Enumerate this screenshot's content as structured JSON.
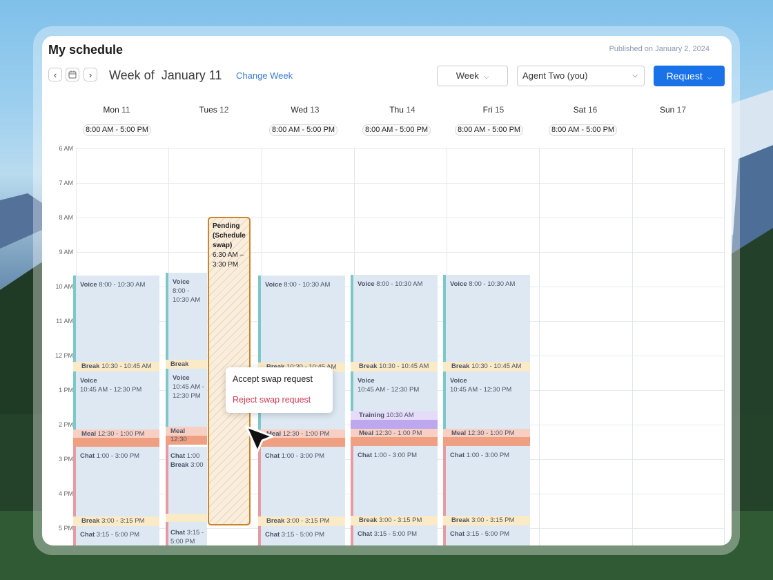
{
  "app": {
    "title": "My schedule",
    "published": "Published on January 2, 2024"
  },
  "toolbar": {
    "prev_icon": "chevron-left-icon",
    "calendar_icon": "calendar-icon",
    "next_icon": "chevron-right-icon",
    "week_of": "Week of  January 11",
    "change_week": "Change Week",
    "view_select": "Week",
    "agent_select": "Agent Two (you)",
    "request_button": "Request"
  },
  "days": [
    {
      "name": "Mon",
      "date": "11",
      "shift": "8:00 AM - 5:00 PM"
    },
    {
      "name": "Tues",
      "date": "12",
      "shift": ""
    },
    {
      "name": "Wed",
      "date": "13",
      "shift": "8:00 AM - 5:00 PM"
    },
    {
      "name": "Thu",
      "date": "14",
      "shift": "8:00 AM - 5:00 PM"
    },
    {
      "name": "Fri",
      "date": "15",
      "shift": "8:00 AM - 5:00 PM"
    },
    {
      "name": "Sat",
      "date": "16",
      "shift": "8:00 AM - 5:00 PM"
    },
    {
      "name": "Sun",
      "date": "17",
      "shift": ""
    }
  ],
  "hours": [
    "6 AM",
    "7 AM",
    "8 AM",
    "9 AM",
    "10 AM",
    "11 AM",
    "12 PM",
    "1 PM",
    "2 PM",
    "3 PM",
    "4 PM",
    "5 PM"
  ],
  "activities": {
    "mon": {
      "voice1_name": "Voice",
      "voice1_time": "8:00 - 10:30 AM",
      "break1_name": "Break",
      "break1_time": "10:30 - 10:45 AM",
      "voice2_name": "Voice",
      "voice2_time": "10:45 AM - 12:30 PM",
      "meal_name": "Meal",
      "meal_time": "12:30 - 1:00 PM",
      "chat1_name": "Chat",
      "chat1_time": "1:00 - 3:00 PM",
      "break2_name": "Break",
      "break2_time": "3:00 - 3:15 PM",
      "chat2_name": "Chat",
      "chat2_time": "3:15 - 5:00 PM"
    },
    "tue": {
      "voice1_name": "Voice",
      "voice1_time": "8:00 - 10:30 AM",
      "break1_name": "Break",
      "voice2_name": "Voice",
      "voice2_time": "10:45 AM - 12:30 PM",
      "meal_name": "Meal",
      "meal_time": "12:30",
      "chat1_name": "Chat",
      "chat1_time": "1:00",
      "break2_name": "Break",
      "break2_time": "3:00",
      "chat2_name": "Chat",
      "chat2_time": "3:15 - 5:00 PM"
    },
    "wed": {
      "voice1_name": "Voice",
      "voice1_time": "8:00 - 10:30 AM",
      "break1_name": "Break",
      "break1_time": "10:30 - 10:45 AM",
      "meal_name": "Meal",
      "meal_time": "12:30 - 1:00 PM",
      "chat1_name": "Chat",
      "chat1_time": "1:00 - 3:00 PM",
      "break2_name": "Break",
      "break2_time": "3:00 - 3:15 PM",
      "chat2_name": "Chat",
      "chat2_time": "3:15 - 5:00 PM"
    },
    "thu": {
      "voice1_name": "Voice",
      "voice1_time": "8:00 - 10:30 AM",
      "break1_name": "Break",
      "break1_time": "10:30 - 10:45 AM",
      "voice2_name": "Voice",
      "voice2_time": "10:45 AM - 12:30 PM",
      "training_name": "Training",
      "training_time": "10:30 AM",
      "meal_name": "Meal",
      "meal_time": "12:30 - 1:00 PM",
      "chat1_name": "Chat",
      "chat1_time": "1:00 - 3:00 PM",
      "break2_name": "Break",
      "break2_time": "3:00 - 3:15 PM",
      "chat2_name": "Chat",
      "chat2_time": "3:15 - 5:00 PM"
    },
    "fri": {
      "voice1_name": "Voice",
      "voice1_time": "8:00 - 10:30 AM",
      "break1_name": "Break",
      "break1_time": "10:30 - 10:45 AM",
      "voice2_name": "Voice",
      "voice2_time": "10:45 AM - 12:30 PM",
      "meal_name": "Meal",
      "meal_time": "12:30 - 1:00 PM",
      "chat1_name": "Chat",
      "chat1_time": "1:00 - 3:00 PM",
      "break2_name": "Break",
      "break2_time": "3:00 - 3:15 PM",
      "chat2_name": "Chat",
      "chat2_time": "3:15 - 5:00 PM"
    }
  },
  "pending": {
    "title": "Pending (Schedule swap)",
    "time": "6:30 AM – 3:30 PM"
  },
  "popup": {
    "accept": "Accept swap request",
    "reject": "Reject swap request"
  },
  "colors": {
    "accent": "#1a72e8",
    "voice_bar": "#7cc8c8",
    "chat_bar": "#e89aa2",
    "pending_border": "#c9852a",
    "reject_text": "#d23a55"
  }
}
